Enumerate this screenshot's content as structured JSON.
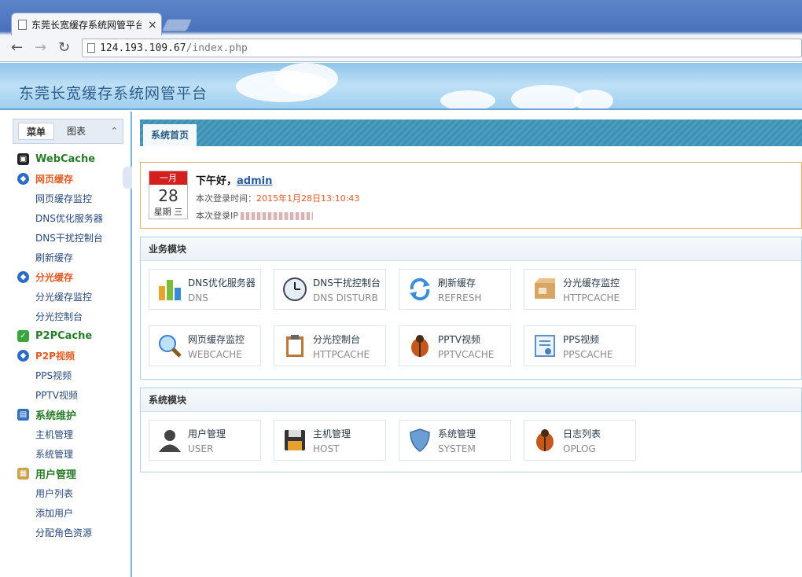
{
  "browser": {
    "tab_title": "东莞长宽缓存系统网管平台",
    "close_glyph": "×",
    "url_host": "124.193.109.67",
    "url_path": "/index.php"
  },
  "banner": {
    "title": "东莞长宽缓存系统网管平台"
  },
  "sidebar": {
    "tabs": [
      "菜单",
      "图表"
    ],
    "collapse_glyph": "⌃",
    "menu": [
      {
        "label": "WebCache",
        "type": "g1",
        "icon": "webcache-icon"
      },
      {
        "label": "网页缓存",
        "type": "g2",
        "icon": "shield-icon"
      },
      {
        "label": "网页缓存监控",
        "type": "sub"
      },
      {
        "label": "DNS优化服务器",
        "type": "sub"
      },
      {
        "label": "DNS干扰控制台",
        "type": "sub"
      },
      {
        "label": "刷新缓存",
        "type": "sub"
      },
      {
        "label": "分光缓存",
        "type": "g2",
        "icon": "shield-icon"
      },
      {
        "label": "分光缓存监控",
        "type": "sub"
      },
      {
        "label": "分光控制台",
        "type": "sub"
      },
      {
        "label": "P2PCache",
        "type": "g1",
        "icon": "check-icon"
      },
      {
        "label": "P2P视频",
        "type": "g2",
        "icon": "shield-icon"
      },
      {
        "label": "PPS视频",
        "type": "sub"
      },
      {
        "label": "PPTV视频",
        "type": "sub"
      },
      {
        "label": "系统维护",
        "type": "g1",
        "icon": "monitor-icon"
      },
      {
        "label": "主机管理",
        "type": "sub"
      },
      {
        "label": "系统管理",
        "type": "sub"
      },
      {
        "label": "用户管理",
        "type": "g1",
        "icon": "users-icon"
      },
      {
        "label": "用户列表",
        "type": "sub"
      },
      {
        "label": "添加用户",
        "type": "sub"
      },
      {
        "label": "分配角色资源",
        "type": "sub"
      }
    ]
  },
  "content": {
    "tab": "系统首页",
    "welcome": {
      "month": "一月",
      "day": "28",
      "weekday": "星期 三",
      "greeting": "下午好，",
      "user": "admin",
      "login_time_label": "本次登录时间：",
      "login_time": "2015年1月28日13:10:43",
      "login_ip_label": "本次登录IP"
    },
    "business": {
      "title": "业务模块",
      "cards": [
        {
          "name": "DNS优化服务器",
          "en": "DNS",
          "icon": "bar-chart-icon"
        },
        {
          "name": "DNS干扰控制台",
          "en": "DNS DISTURB",
          "icon": "clock-icon"
        },
        {
          "name": "刷新缓存",
          "en": "REFRESH",
          "icon": "refresh-icon"
        },
        {
          "name": "分光缓存监控",
          "en": "HTTPCACHE",
          "icon": "box-icon"
        },
        {
          "name": "网页缓存监控",
          "en": "WEBCACHE",
          "icon": "magnifier-icon"
        },
        {
          "name": "分光控制台",
          "en": "HTTPCACHE",
          "icon": "clipboard-icon"
        },
        {
          "name": "PPTV视频",
          "en": "PPTVCACHE",
          "icon": "bug-icon"
        },
        {
          "name": "PPS视频",
          "en": "PPSCACHE",
          "icon": "certificate-icon"
        }
      ]
    },
    "system": {
      "title": "系统模块",
      "cards": [
        {
          "name": "用户管理",
          "en": "USER",
          "icon": "user-icon"
        },
        {
          "name": "主机管理",
          "en": "HOST",
          "icon": "floppy-icon"
        },
        {
          "name": "系统管理",
          "en": "SYSTEM",
          "icon": "shield-icon"
        },
        {
          "name": "日志列表",
          "en": "OPLOG",
          "icon": "bug-icon"
        }
      ]
    }
  }
}
